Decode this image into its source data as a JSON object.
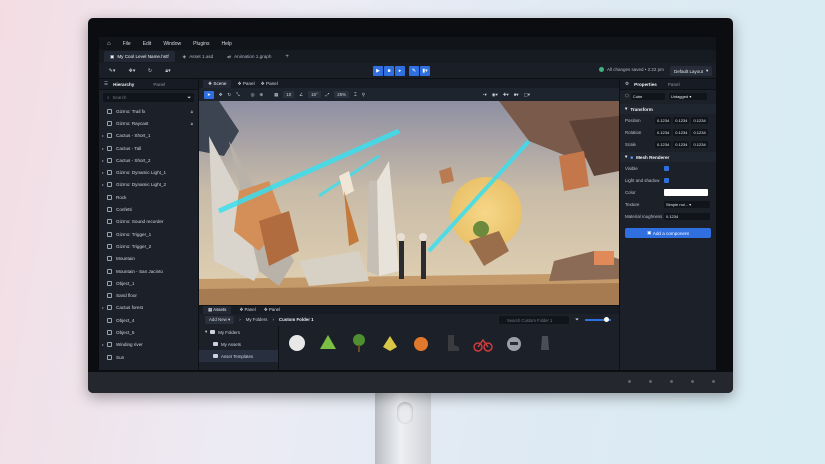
{
  "menu": {
    "items": [
      "File",
      "Edit",
      "Window",
      "Plugins",
      "Help"
    ]
  },
  "tabs": [
    {
      "label": "My Cool Level Name.hstf"
    },
    {
      "label": "Asset 1.asd"
    },
    {
      "label": "Animation 1.graph"
    }
  ],
  "toolbar": {
    "status": "All changes saved • 2:22 pm",
    "layout": "Default Layout"
  },
  "hierarchy": {
    "title": "Hierarchy",
    "panel_tab": "Panel",
    "search_placeholder": "Search",
    "items": [
      {
        "label": "Gizmo: Trail fx"
      },
      {
        "label": "Gizmo: Raycast"
      },
      {
        "label": "Cactus - Short_1"
      },
      {
        "label": "Cactus - Tall"
      },
      {
        "label": "Cactus - Short_2"
      },
      {
        "label": "Gizmo: Dynamic Light_1"
      },
      {
        "label": "Gizmo: Dynamic Light_2"
      },
      {
        "label": "Rock"
      },
      {
        "label": "Confetti"
      },
      {
        "label": "Gizmo: Sound recorder"
      },
      {
        "label": "Gizmo: Trigger_1"
      },
      {
        "label": "Gizmo: Trigger_2"
      },
      {
        "label": "Mountain"
      },
      {
        "label": "Mountain - San Jacinto"
      },
      {
        "label": "Object_1"
      },
      {
        "label": "Sand floor"
      },
      {
        "label": "Cactus forest"
      },
      {
        "label": "Object_4"
      },
      {
        "label": "Object_5"
      },
      {
        "label": "Winding river"
      },
      {
        "label": "Sun"
      }
    ]
  },
  "viewport": {
    "tabs": [
      "Scene",
      "Panel",
      "Panel"
    ],
    "tools": {
      "grid": "10",
      "angle": "15°",
      "scale": "25%"
    }
  },
  "assets": {
    "tabs": [
      "Assets",
      "Panel",
      "Panel"
    ],
    "add_label": "Add New",
    "breadcrumb": [
      "My Folders",
      "Custom Folder 1"
    ],
    "search_placeholder": "Search Custom Folder 1",
    "folders": [
      "My Folders",
      "My Assets",
      "Asset Templates"
    ]
  },
  "properties": {
    "title": "Properties",
    "panel_tab": "Panel",
    "object_name": "Cube",
    "tag": "Untagged",
    "transform_title": "Transform",
    "position_label": "Position",
    "rotation_label": "Rotation",
    "scale_label": "Scale",
    "value": "0.1234",
    "mesh_title": "Mesh Renderer",
    "visible_label": "Visible",
    "light_label": "Light and shadow",
    "color_label": "Color",
    "texture_label": "Texture",
    "texture_value": "Simple noi...",
    "roughness_label": "Material roughness",
    "roughness_value": "0.1234",
    "add_component": "Add a component"
  }
}
